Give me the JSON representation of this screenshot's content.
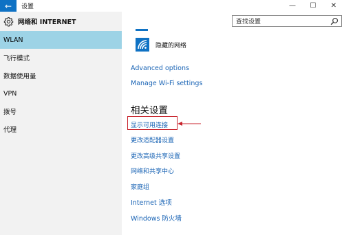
{
  "window": {
    "title": "设置",
    "back_glyph": "←",
    "minimize_glyph": "—",
    "maximize_glyph": "☐",
    "close_glyph": "✕"
  },
  "sidebar": {
    "header_icon": "gear-icon",
    "header_title": "网络和 INTERNET",
    "items": [
      {
        "label": "WLAN",
        "active": true
      },
      {
        "label": "飞行模式",
        "active": false
      },
      {
        "label": "数据使用量",
        "active": false
      },
      {
        "label": "VPN",
        "active": false
      },
      {
        "label": "拨号",
        "active": false
      },
      {
        "label": "代理",
        "active": false
      }
    ]
  },
  "search": {
    "placeholder": "查找设置",
    "icon": "search-icon"
  },
  "main": {
    "hidden_network_label": "隐藏的网络",
    "advanced_options": "Advanced options",
    "manage_wifi": "Manage Wi-Fi settings",
    "related_heading": "相关设置",
    "related_links": [
      "显示可用连接",
      "更改适配器设置",
      "更改高级共享设置",
      "网络和共享中心",
      "家庭组",
      "Internet 选项",
      "Windows 防火墙"
    ]
  },
  "colors": {
    "accent": "#0f72c4",
    "link": "#1a64b5",
    "sidebar_bg": "#f2f2f2",
    "active_item_bg": "#9dd3e6",
    "annotation_red": "#c8232c"
  }
}
